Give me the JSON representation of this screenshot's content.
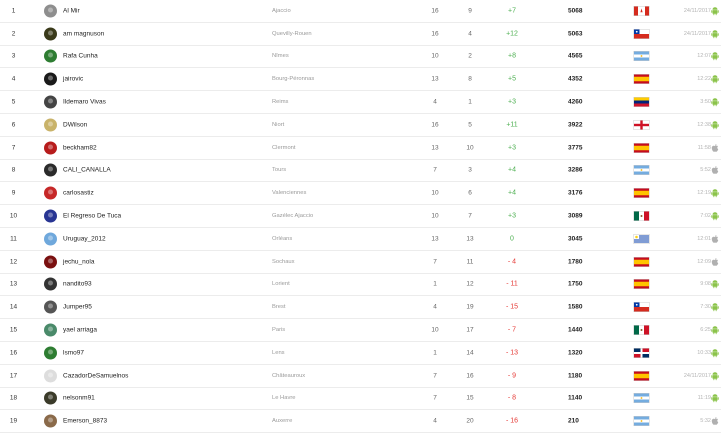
{
  "rows": [
    {
      "rank": "1",
      "name": "Al Mir",
      "team": "Ajaccio",
      "a": "16",
      "b": "9",
      "diff": "+7",
      "sign": "pos",
      "points": "5068",
      "flag": "ca-flag",
      "date": "24/11/2017",
      "os": "android-icon",
      "avatar": "#8e8e8e"
    },
    {
      "rank": "2",
      "name": "am magnuson",
      "team": "Quevilly-Rouen",
      "a": "16",
      "b": "4",
      "diff": "+12",
      "sign": "pos",
      "points": "5063",
      "flag": "cl-flag",
      "date": "24/11/2017",
      "os": "android-icon",
      "avatar": "#3a3a1a"
    },
    {
      "rank": "3",
      "name": "Rafa Cunha",
      "team": "Nîmes",
      "a": "10",
      "b": "2",
      "diff": "+8",
      "sign": "pos",
      "points": "4565",
      "flag": "ar-flag",
      "date": "12:07",
      "os": "android-icon",
      "avatar": "#2e7d32"
    },
    {
      "rank": "4",
      "name": "jairovic",
      "team": "Bourg-Péronnas",
      "a": "13",
      "b": "8",
      "diff": "+5",
      "sign": "pos",
      "points": "4352",
      "flag": "es-flag",
      "date": "12:22",
      "os": "android-icon",
      "avatar": "#1a1a1a"
    },
    {
      "rank": "5",
      "name": "Ildemaro Vivas",
      "team": "Reims",
      "a": "4",
      "b": "1",
      "diff": "+3",
      "sign": "pos",
      "points": "4260",
      "flag": "ve-flag",
      "date": "3:50",
      "os": "android-icon",
      "avatar": "#444444"
    },
    {
      "rank": "6",
      "name": "DWilson",
      "team": "Niort",
      "a": "16",
      "b": "5",
      "diff": "+11",
      "sign": "pos",
      "points": "3922",
      "flag": "en-flag",
      "date": "12:38",
      "os": "android-icon",
      "avatar": "#c9b36a"
    },
    {
      "rank": "7",
      "name": "beckham82",
      "team": "Clermont",
      "a": "13",
      "b": "10",
      "diff": "+3",
      "sign": "pos",
      "points": "3775",
      "flag": "es-flag",
      "date": "11:58",
      "os": "apple-icon",
      "avatar": "#b71c1c"
    },
    {
      "rank": "8",
      "name": "CALI_CANALLA",
      "team": "Tours",
      "a": "7",
      "b": "3",
      "diff": "+4",
      "sign": "pos",
      "points": "3286",
      "flag": "ar-flag",
      "date": "5:52",
      "os": "apple-icon",
      "avatar": "#2b2b2b"
    },
    {
      "rank": "9",
      "name": "carlosastiz",
      "team": "Valenciennes",
      "a": "10",
      "b": "6",
      "diff": "+4",
      "sign": "pos",
      "points": "3176",
      "flag": "es-flag",
      "date": "12:19",
      "os": "android-icon",
      "avatar": "#c62828"
    },
    {
      "rank": "10",
      "name": "El Regreso De Tuca",
      "team": "Gazélec Ajaccio",
      "a": "10",
      "b": "7",
      "diff": "+3",
      "sign": "pos",
      "points": "3089",
      "flag": "mx-flag",
      "date": "7:02",
      "os": "android-icon",
      "avatar": "#283593"
    },
    {
      "rank": "11",
      "name": "Uruguay_2012",
      "team": "Orléans",
      "a": "13",
      "b": "13",
      "diff": "0",
      "sign": "zero",
      "points": "3045",
      "flag": "uy-flag",
      "date": "12:01",
      "os": "apple-icon",
      "avatar": "#6fa8dc"
    },
    {
      "rank": "12",
      "name": "jechu_nola",
      "team": "Sochaux",
      "a": "7",
      "b": "11",
      "diff": "- 4",
      "sign": "neg",
      "points": "1780",
      "flag": "es-flag",
      "date": "12:09",
      "os": "apple-icon",
      "avatar": "#7a1010"
    },
    {
      "rank": "13",
      "name": "nandito93",
      "team": "Lorient",
      "a": "1",
      "b": "12",
      "diff": "- 11",
      "sign": "neg",
      "points": "1750",
      "flag": "es-flag",
      "date": "9:08",
      "os": "android-icon",
      "avatar": "#333333"
    },
    {
      "rank": "14",
      "name": "Jumper95",
      "team": "Brest",
      "a": "4",
      "b": "19",
      "diff": "- 15",
      "sign": "neg",
      "points": "1580",
      "flag": "cl-flag",
      "date": "7:30",
      "os": "android-icon",
      "avatar": "#555555"
    },
    {
      "rank": "15",
      "name": "yael arriaga",
      "team": "Paris",
      "a": "10",
      "b": "17",
      "diff": "- 7",
      "sign": "neg",
      "points": "1440",
      "flag": "mx-flag",
      "date": "6:25",
      "os": "android-icon",
      "avatar": "#4a8a6a"
    },
    {
      "rank": "16",
      "name": "lsmo97",
      "team": "Lens",
      "a": "1",
      "b": "14",
      "diff": "- 13",
      "sign": "neg",
      "points": "1320",
      "flag": "do-flag",
      "date": "10:33",
      "os": "android-icon",
      "avatar": "#2e7d32"
    },
    {
      "rank": "17",
      "name": "CazadorDeSamuelnos",
      "team": "Châteauroux",
      "a": "7",
      "b": "16",
      "diff": "- 9",
      "sign": "neg",
      "points": "1180",
      "flag": "es-flag",
      "date": "24/11/2017",
      "os": "android-icon",
      "avatar": "#dddddd"
    },
    {
      "rank": "18",
      "name": "nelsonm91",
      "team": "Le Havre",
      "a": "7",
      "b": "15",
      "diff": "- 8",
      "sign": "neg",
      "points": "1140",
      "flag": "ar-flag",
      "date": "11:19",
      "os": "android-icon",
      "avatar": "#3b3b2a"
    },
    {
      "rank": "19",
      "name": "Emerson_8873",
      "team": "Auxerre",
      "a": "4",
      "b": "20",
      "diff": "- 16",
      "sign": "neg",
      "points": "210",
      "flag": "ar-flag",
      "date": "5:32",
      "os": "apple-icon",
      "avatar": "#8a6a4a"
    }
  ],
  "colors": {
    "positive": "#4caf50",
    "negative": "#e53935",
    "android": "#8bc34a",
    "apple": "#b0b0b0"
  }
}
